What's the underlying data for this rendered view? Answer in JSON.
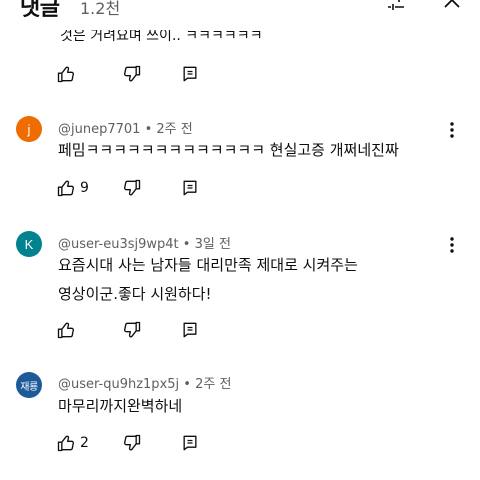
{
  "header": {
    "title": "댓글",
    "count": "1.2천"
  },
  "partial_comment": {
    "text": "것은 거려요며 쓰이.. ㅋㅋㅋㅋㅋㅋ"
  },
  "comments": [
    {
      "avatar_letter": "j",
      "avatar_color": "#ef6c00",
      "username": "@junep7701",
      "time": "2주 전",
      "lines": [
        "페밈ㅋㅋㅋㅋㅋㅋㅋㅋㅋㅋㅋㅋㅋ 현실고증 개쩌네진짜"
      ],
      "likes": "9"
    },
    {
      "avatar_letter": "K",
      "avatar_color": "#00838f",
      "username": "@user-eu3sj9wp4t",
      "time": "3일 전",
      "lines": [
        "요즘시대 사는 남자들 대리만족 제대로 시켜주는",
        "영상이군.좋다 시원하다!"
      ],
      "likes": ""
    },
    {
      "avatar_letter": "재룡",
      "avatar_color": "#1e5a9a",
      "username": "@user-qu9hz1px5j",
      "time": "2주 전",
      "lines": [
        "마무리까지완벽하네"
      ],
      "likes": "2"
    }
  ],
  "icons": {
    "filter": "filter-sliders-icon",
    "close": "close-icon",
    "like": "thumb-up-icon",
    "dislike": "thumb-down-icon",
    "reply": "reply-icon",
    "more": "more-vert-icon"
  }
}
